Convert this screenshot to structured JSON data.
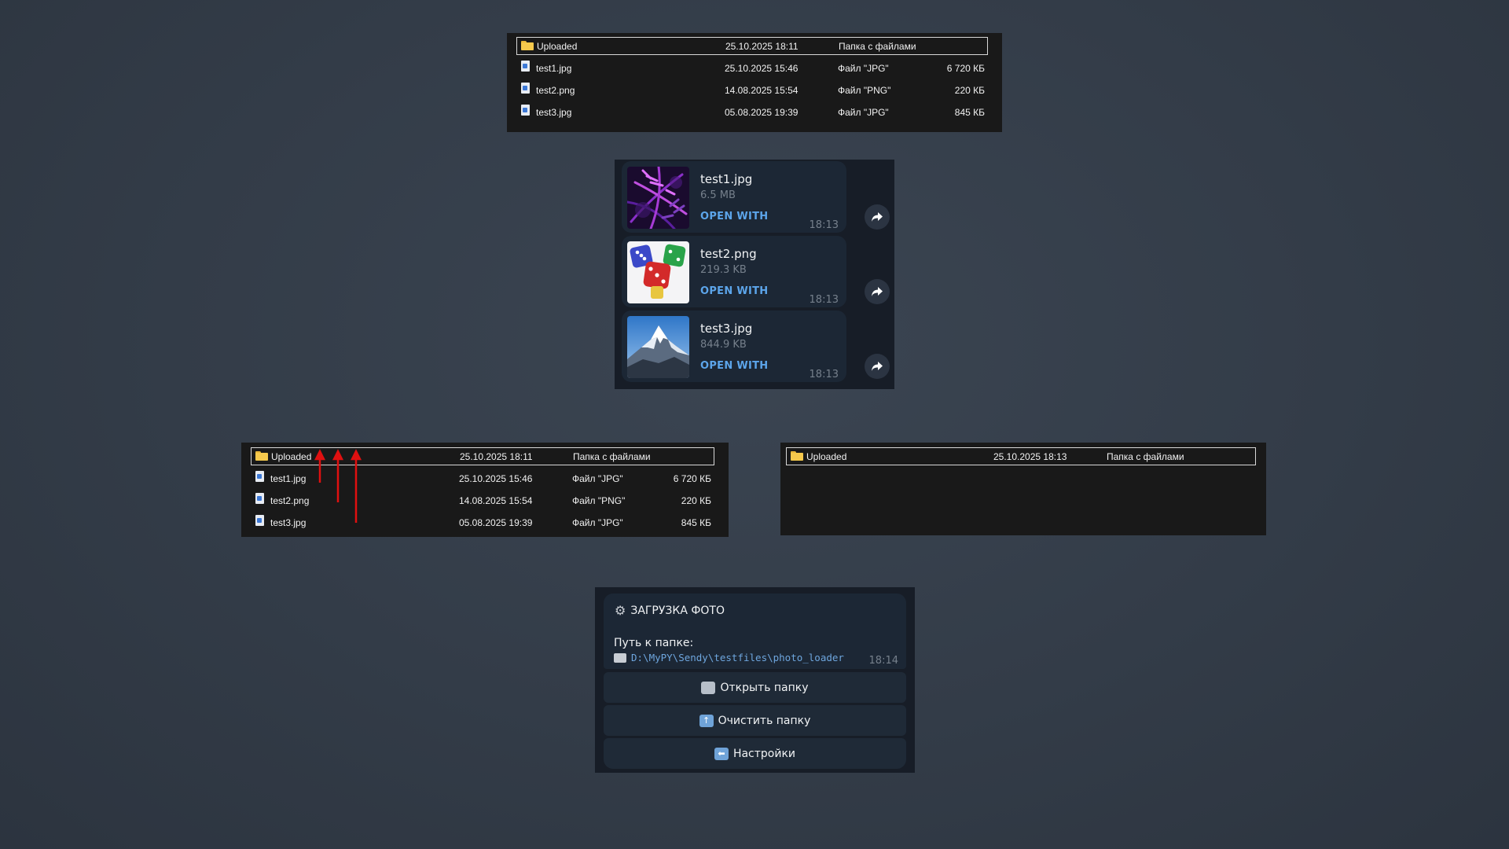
{
  "explorer_top": {
    "rows": [
      {
        "name": "Uploaded",
        "date": "25.10.2025 18:11",
        "type": "Папка с файлами",
        "size": ""
      },
      {
        "name": "test1.jpg",
        "date": "25.10.2025 15:46",
        "type": "Файл \"JPG\"",
        "size": "6 720 КБ"
      },
      {
        "name": "test2.png",
        "date": "14.08.2025 15:54",
        "type": "Файл \"PNG\"",
        "size": "220 КБ"
      },
      {
        "name": "test3.jpg",
        "date": "05.08.2025 19:39",
        "type": "Файл \"JPG\"",
        "size": "845 КБ"
      }
    ]
  },
  "telegram_files": {
    "open_label": "OPEN WITH",
    "items": [
      {
        "name": "test1.jpg",
        "size": "6.5 MB",
        "time": "18:13"
      },
      {
        "name": "test2.png",
        "size": "219.3 KB",
        "time": "18:13"
      },
      {
        "name": "test3.jpg",
        "size": "844.9 KB",
        "time": "18:13"
      }
    ]
  },
  "explorer_left": {
    "rows": [
      {
        "name": "Uploaded",
        "date": "25.10.2025 18:11",
        "type": "Папка с файлами",
        "size": ""
      },
      {
        "name": "test1.jpg",
        "date": "25.10.2025 15:46",
        "type": "Файл \"JPG\"",
        "size": "6 720 КБ"
      },
      {
        "name": "test2.png",
        "date": "14.08.2025 15:54",
        "type": "Файл \"PNG\"",
        "size": "220 КБ"
      },
      {
        "name": "test3.jpg",
        "date": "05.08.2025 19:39",
        "type": "Файл \"JPG\"",
        "size": "845 КБ"
      }
    ]
  },
  "explorer_right": {
    "rows": [
      {
        "name": "Uploaded",
        "date": "25.10.2025 18:13",
        "type": "Папка с файлами",
        "size": ""
      }
    ]
  },
  "bot": {
    "title": "ЗАГРУЗКА ФОТО",
    "path_label": "Путь к папке:",
    "path": "D:\\MyPY\\Sendy\\testfiles\\photo_loader",
    "time": "18:14",
    "buttons": [
      {
        "label": "Открыть папку",
        "icon": "open-folder-icon"
      },
      {
        "label": "Очистить папку",
        "icon": "upload-arrow-icon"
      },
      {
        "label": "Настройки",
        "icon": "back-arrow-icon"
      }
    ]
  },
  "colors": {
    "background": "#37414d",
    "explorer_bg": "#191919",
    "telegram_bubble": "#1c2735",
    "link_blue": "#5ca5ea",
    "arrow_red": "#e01010"
  }
}
